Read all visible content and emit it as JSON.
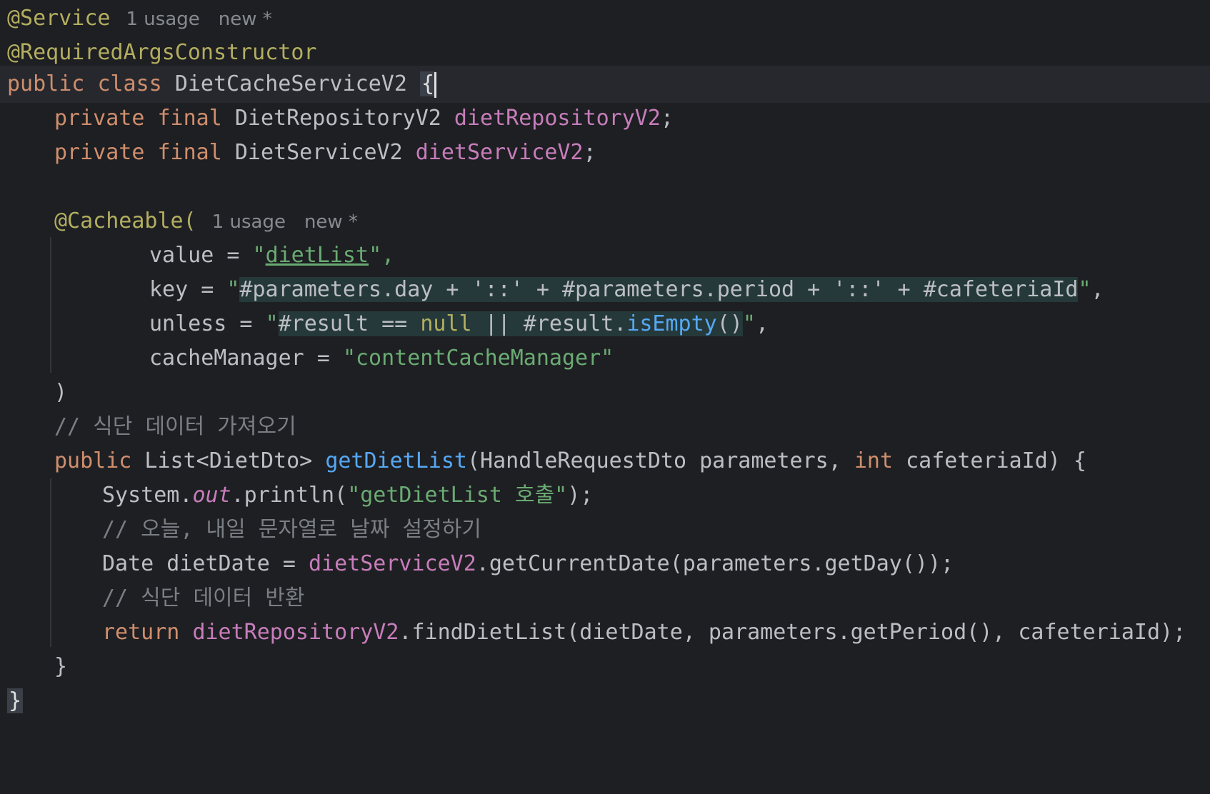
{
  "hints": {
    "usage": "1 usage",
    "new": "new *"
  },
  "lines": {
    "l1": {
      "annotation": "@Service"
    },
    "l2": {
      "annotation": "@RequiredArgsConstructor"
    },
    "l3": {
      "kw1": "public",
      "kw2": "class",
      "name": "DietCacheServiceV2",
      "brace": "{"
    },
    "l4": {
      "kw1": "private",
      "kw2": "final",
      "type": "DietRepositoryV2",
      "field": "dietRepositoryV2",
      "end": ";"
    },
    "l5": {
      "kw1": "private",
      "kw2": "final",
      "type": "DietServiceV2",
      "field": "dietServiceV2",
      "end": ";"
    },
    "l7": {
      "annotation": "@Cacheable("
    },
    "l8": {
      "name": "value",
      "eq": " = ",
      "q1": "\"",
      "val": "dietList",
      "q2": "\",",
      "tail": ""
    },
    "l9": {
      "name": "key",
      "eq": " = ",
      "q1": "\"",
      "expr": "#parameters.day + '::' + #parameters.period + '::' + #cafeteriaId",
      "q2": "\"",
      "tail": ","
    },
    "l10": {
      "name": "unless",
      "eq": " = ",
      "q1": "\"",
      "e1": "#result == ",
      "e2": "null",
      "e3": " || #result.",
      "e4": "isEmpty",
      "e5": "()",
      "q2": "\"",
      "tail": ","
    },
    "l11": {
      "name": "cacheManager",
      "eq": " = ",
      "val": "\"contentCacheManager\""
    },
    "l12": {
      "text": ")"
    },
    "l13": {
      "comment": "// 식단 데이터 가져오기"
    },
    "l14": {
      "kw1": "public",
      "type": " List<DietDto> ",
      "fn": "getDietList",
      "params1": "(HandleRequestDto parameters, ",
      "kw2": "int",
      "params2": " cafeteriaId) {"
    },
    "l15": {
      "a": "System.",
      "b": "out",
      "c": ".println(",
      "d": "\"getDietList 호출\"",
      "e": ");"
    },
    "l16": {
      "comment": "// 오늘, 내일 문자열로 날짜 설정하기"
    },
    "l17": {
      "a": "Date dietDate = ",
      "b": "dietServiceV2",
      "c": ".getCurrentDate(parameters.getDay());"
    },
    "l18": {
      "comment": "// 식단 데이터 반환"
    },
    "l19": {
      "kw": "return",
      "b": "dietRepositoryV2",
      "c": ".findDietList(dietDate, parameters.getPeriod(), cafeteriaId);"
    },
    "l20": {
      "text": "}"
    },
    "l21": {
      "text": "}"
    }
  },
  "colors": {
    "background": "#1e1f22",
    "current_line": "#26282e",
    "keyword": "#cf8e6d",
    "annotation": "#b3ae60",
    "field": "#c77dbb",
    "string": "#6aab73",
    "method": "#56a8f5",
    "comment": "#7a7e85",
    "text": "#bcbec4"
  }
}
